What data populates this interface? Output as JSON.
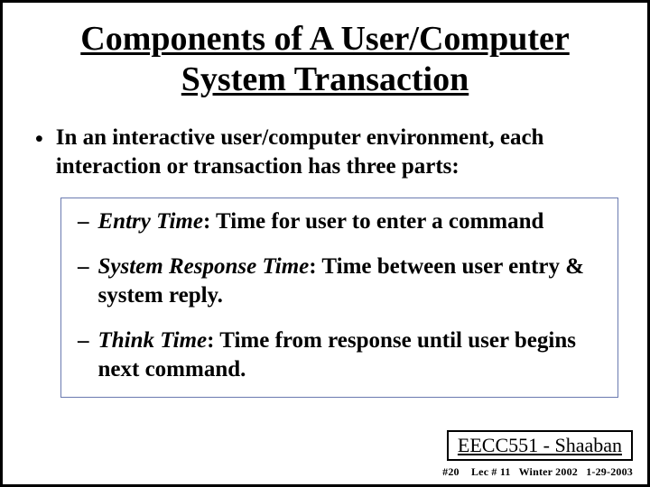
{
  "title": "Components of A User/Computer System Transaction",
  "intro": {
    "bullet_glyph": "•",
    "text": "In an interactive user/computer environment, each interaction or transaction has three parts:"
  },
  "subs": [
    {
      "dash": "–",
      "label": "Entry Time",
      "desc": ": Time for user to enter a command"
    },
    {
      "dash": "–",
      "label": "System Response Time",
      "desc": ":  Time between user entry & system reply."
    },
    {
      "dash": "–",
      "label": "Think Time",
      "desc": ":  Time from response until user begins next command."
    }
  ],
  "footer": {
    "course": "EECC551 - Shaaban",
    "slide_no": "#20",
    "lecture": "Lec # 11",
    "term": "Winter 2002",
    "date": "1-29-2003"
  }
}
